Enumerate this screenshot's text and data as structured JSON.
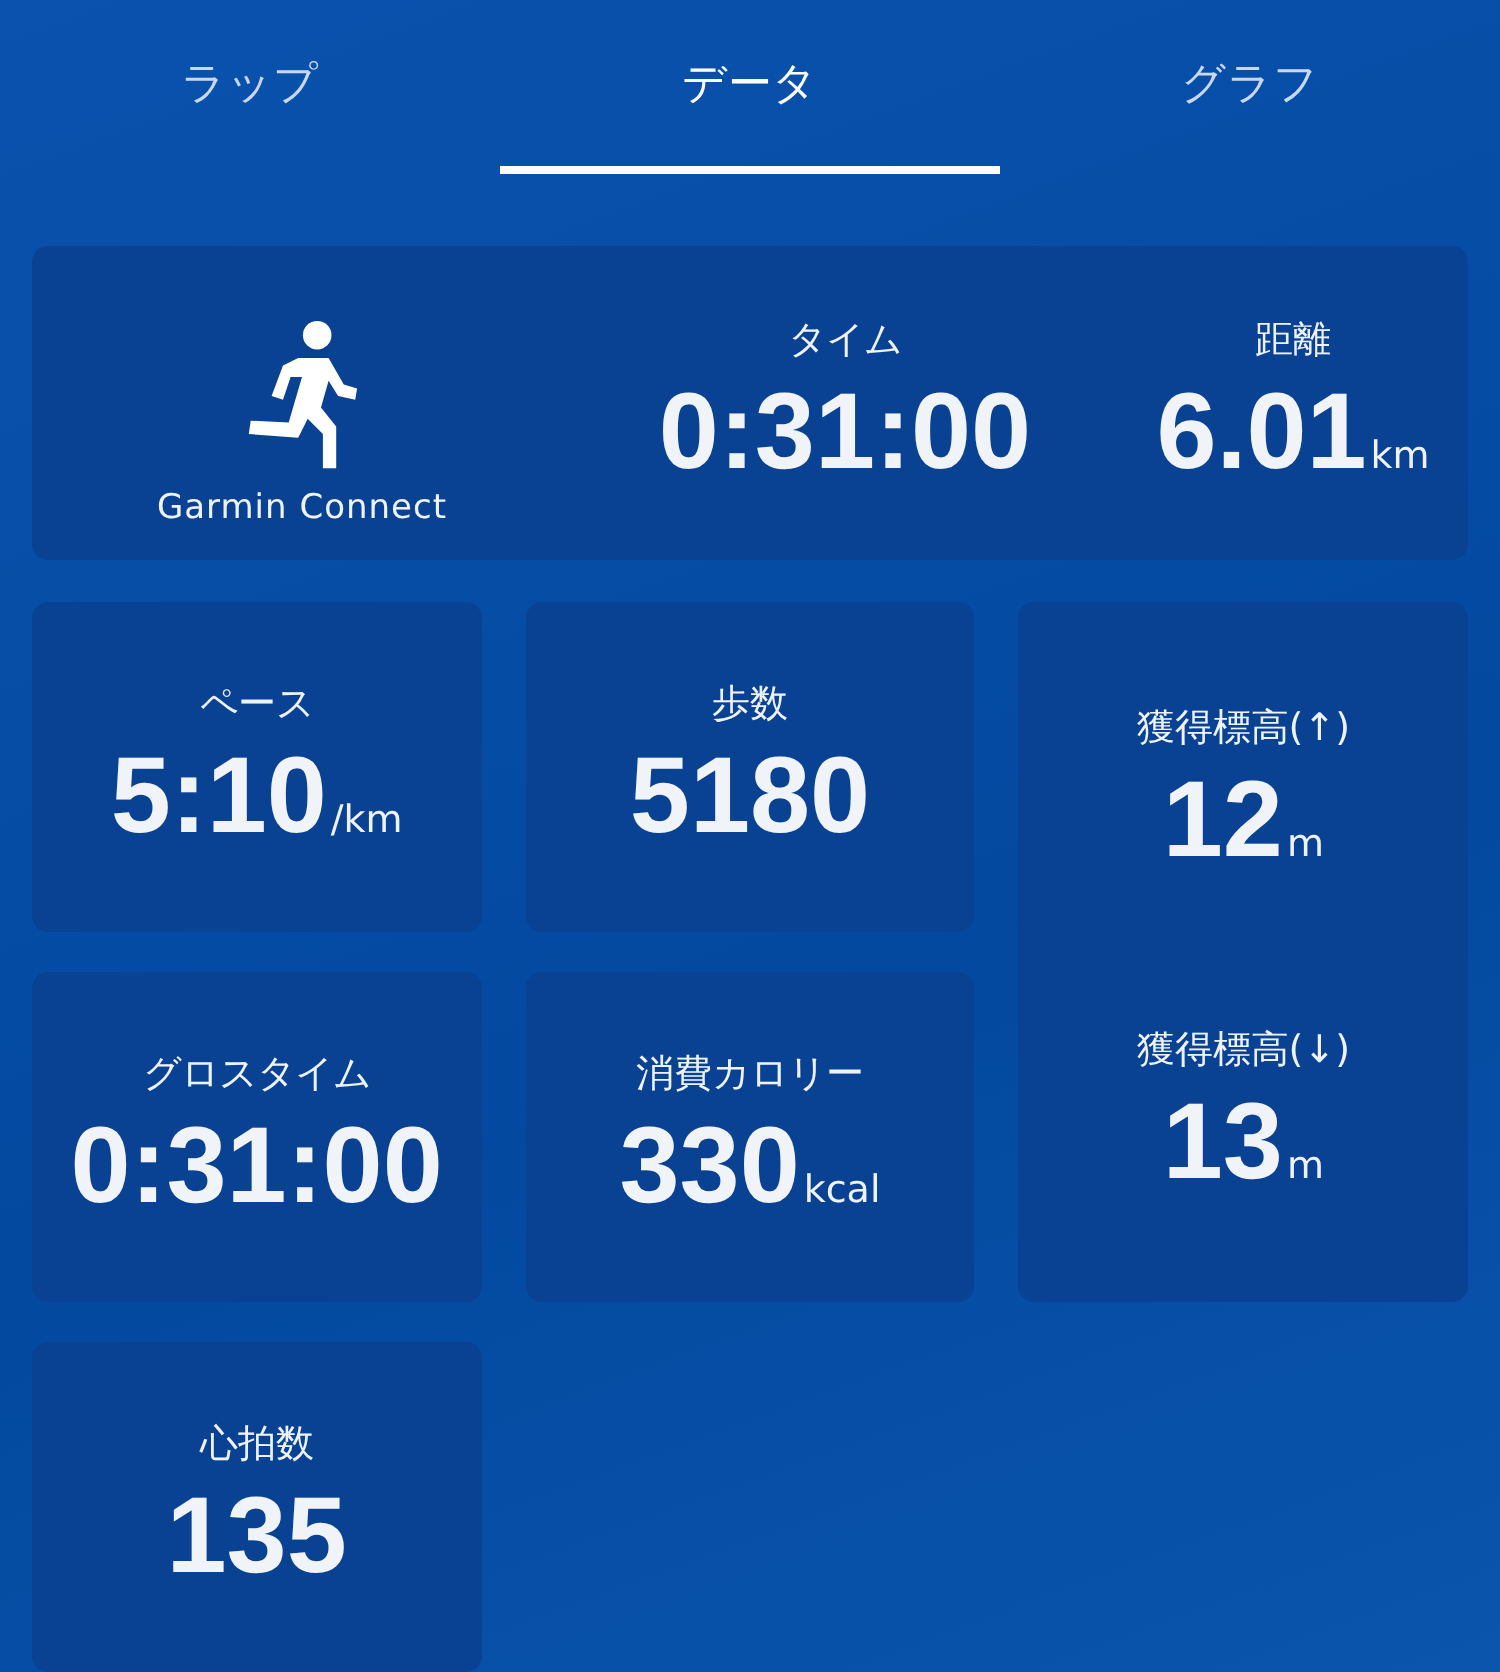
{
  "tabs": [
    {
      "label": "ラップ",
      "selected": false
    },
    {
      "label": "データ",
      "selected": true
    },
    {
      "label": "グラフ",
      "selected": false
    }
  ],
  "summary": {
    "app_label": "Garmin Connect",
    "stats": [
      {
        "label": "タイム",
        "value": "0:31:00"
      },
      {
        "label": "距離",
        "value": "6.01",
        "unit": "km"
      }
    ]
  },
  "tiles": [
    {
      "stats": [
        {
          "label": "ペース",
          "value": "5:10",
          "unit": "/km"
        }
      ]
    },
    {
      "stats": [
        {
          "label": "歩数",
          "value": "5180"
        }
      ]
    },
    {
      "stats": [
        {
          "label": "獲得標高(↑)",
          "value": "12",
          "unit": "m"
        },
        {
          "label": "獲得標高(↓)",
          "value": "13",
          "unit": "m"
        }
      ]
    },
    {
      "stats": [
        {
          "label": "グロスタイム",
          "value": "0:31:00"
        }
      ]
    },
    {
      "stats": [
        {
          "label": "消費カロリー",
          "value": "330",
          "unit": "kcal"
        }
      ]
    },
    {
      "stats": [
        {
          "label": "心拍数",
          "value": "135"
        }
      ]
    }
  ]
}
